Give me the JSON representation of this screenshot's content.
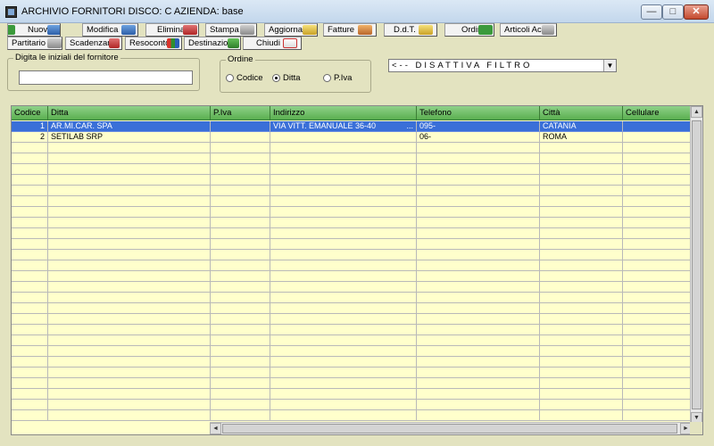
{
  "window": {
    "title": "ARCHIVIO FORNITORI   DISCO: C   AZIENDA: base",
    "min_glyph": "—",
    "max_glyph": "□",
    "close_glyph": "✕"
  },
  "toolbar1": [
    {
      "id": "nuovo",
      "label": "Nuovo",
      "icon": "add-record-icon"
    },
    {
      "id": "modifica",
      "label": "Modifica",
      "icon": "edit-record-icon"
    },
    {
      "id": "elimina",
      "label": "Elimina",
      "icon": "delete-record-icon"
    },
    {
      "id": "stampa",
      "label": "Stampa",
      "icon": "printer-icon"
    },
    {
      "id": "aggiorna",
      "label": "Aggiorna",
      "icon": "refresh-icon"
    },
    {
      "id": "fatture",
      "label": "Fatture",
      "icon": "invoice-icon"
    },
    {
      "id": "ddt",
      "label": "D.d.T.",
      "icon": "delivery-note-icon"
    },
    {
      "id": "ordini",
      "label": "Ordini",
      "icon": "orders-icon"
    },
    {
      "id": "articoli",
      "label": "Articoli Acq.",
      "icon": "purchased-items-icon"
    }
  ],
  "toolbar2": [
    {
      "id": "partitario",
      "label": "Partitario",
      "icon": "ledger-icon"
    },
    {
      "id": "scadenzario",
      "label": "Scadenzario",
      "icon": "deadline-icon"
    },
    {
      "id": "resoconto",
      "label": "Resoconto",
      "icon": "report-icon"
    },
    {
      "id": "destinazioni",
      "label": "Destinazioni",
      "icon": "destinations-icon"
    },
    {
      "id": "chiudi",
      "label": "Chiudi",
      "icon": "exit-icon"
    }
  ],
  "search": {
    "label": "Digita le iniziali del fornitore",
    "value": ""
  },
  "order": {
    "label": "Ordine",
    "options": [
      "Codice",
      "Ditta",
      "P.Iva"
    ],
    "selected": "Ditta"
  },
  "filter": {
    "selected": "<-- DISATTIVA FILTRO",
    "arrow": "▼"
  },
  "grid": {
    "columns": [
      "Codice",
      "Ditta",
      "P.Iva",
      "Indirizzo",
      "Telefono",
      "Città",
      "Cellulare"
    ],
    "rows": [
      {
        "codice": "1",
        "ditta": "AR.MI.CAR. SPA",
        "piva": "",
        "indirizzo": "VIA VITT. EMANUALE 36-40",
        "indirizzo_more": "...",
        "telefono": "095-",
        "citta": "CATANIA",
        "cellulare": ""
      },
      {
        "codice": "2",
        "ditta": "SETILAB SRP",
        "piva": "",
        "indirizzo": "",
        "indirizzo_more": "",
        "telefono": "06-",
        "citta": "ROMA",
        "cellulare": ""
      }
    ],
    "selected_row": 0
  },
  "scroll": {
    "up": "▲",
    "down": "▼",
    "left": "◄",
    "right": "►"
  }
}
